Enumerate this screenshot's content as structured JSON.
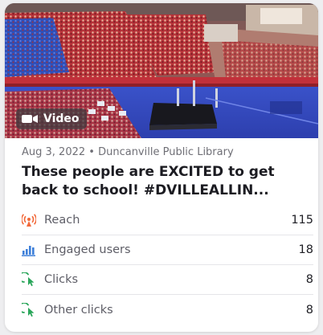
{
  "post": {
    "media_type_label": "Video",
    "date": "Aug 3, 2022",
    "separator": "•",
    "page_name": "Duncanville Public Library",
    "title_line1": "These people are EXCITED to get",
    "title_line2": "back to school! #DVILLEALLIN..."
  },
  "stats": [
    {
      "label": "Reach",
      "value": "115",
      "icon": "reach-icon",
      "color": "#f2693a"
    },
    {
      "label": "Engaged users",
      "value": "18",
      "icon": "bar-chart-icon",
      "color": "#3d7fd9"
    },
    {
      "label": "Clicks",
      "value": "8",
      "icon": "cursor-click-icon",
      "color": "#2aa65a"
    },
    {
      "label": "Other clicks",
      "value": "8",
      "icon": "cursor-click-icon",
      "color": "#2aa65a"
    }
  ]
}
